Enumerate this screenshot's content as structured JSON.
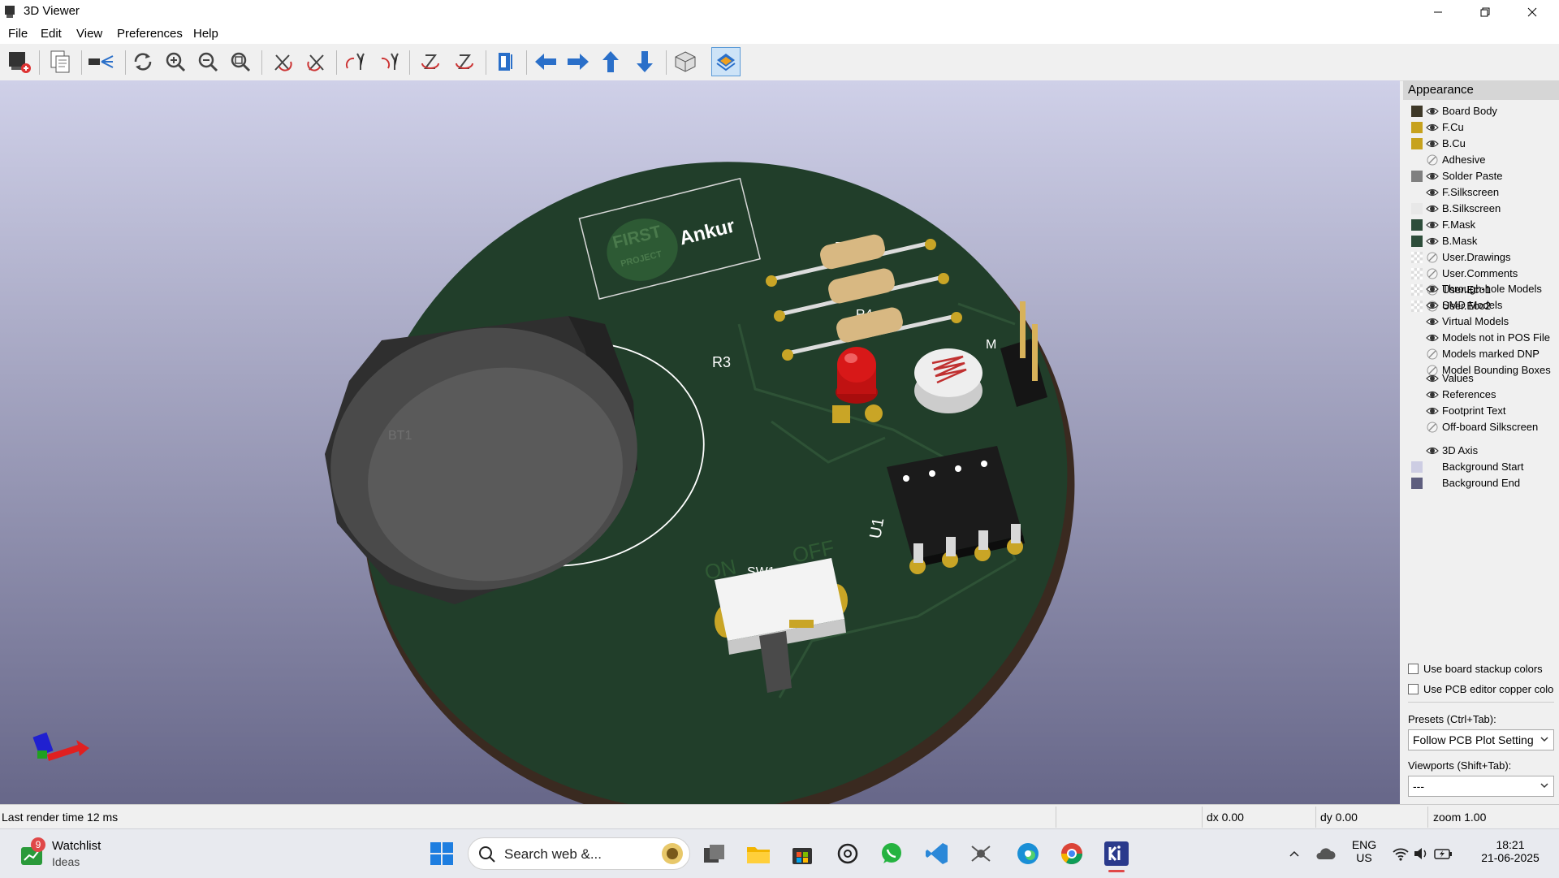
{
  "window": {
    "title": "3D Viewer",
    "controls": [
      "minimize-icon",
      "restore-icon",
      "close-icon"
    ]
  },
  "menu": [
    "File",
    "Edit",
    "View",
    "Preferences",
    "Help"
  ],
  "toolbar": {
    "icons": [
      "reload-board-icon",
      "copy-image-icon",
      "raytrace-icon",
      "refresh-icon",
      "zoom-in-icon",
      "zoom-out-icon",
      "zoom-fit-icon",
      "rotate-x-cw-icon",
      "rotate-x-ccw-icon",
      "rotate-y-cw-icon",
      "rotate-y-ccw-icon",
      "rotate-z-cw-icon",
      "rotate-z-ccw-icon",
      "flip-board-icon",
      "pan-left-icon",
      "pan-right-icon",
      "pan-up-icon",
      "pan-down-icon",
      "orthographic-icon",
      "layers-manager-icon"
    ]
  },
  "board": {
    "silkscreen": [
      "Ankur",
      "FIRST",
      "PROJECT",
      "R1",
      "R4",
      "R3",
      "BT1",
      "U1",
      "ON",
      "OFF",
      "SW1",
      "M"
    ],
    "colors": {
      "soldermask": "#213e2a",
      "copper": "#c9a526",
      "silk": "#ffffff",
      "bg_top": "#cfd0e8",
      "bg_bottom": "#676789"
    }
  },
  "appearance": {
    "title": "Appearance",
    "layers": [
      {
        "label": "Board Body",
        "color": "#3e3828",
        "visible": true
      },
      {
        "label": "F.Cu",
        "color": "#c7a21e",
        "visible": true
      },
      {
        "label": "B.Cu",
        "color": "#c7a21e",
        "visible": true
      },
      {
        "label": "Adhesive",
        "color": "",
        "visible": false
      },
      {
        "label": "Solder Paste",
        "color": "#808080",
        "visible": true
      },
      {
        "label": "F.Silkscreen",
        "color": "#f0f0f0",
        "visible": true
      },
      {
        "label": "B.Silkscreen",
        "color": "#e8e8e8",
        "visible": true
      },
      {
        "label": "F.Mask",
        "color": "#2d4d3a",
        "visible": true
      },
      {
        "label": "B.Mask",
        "color": "#2d4d3a",
        "visible": true
      },
      {
        "label": "User.Drawings",
        "color": "checker",
        "visible": false
      },
      {
        "label": "User.Comments",
        "color": "checker",
        "visible": false
      },
      {
        "label": "User.Eco1",
        "color": "checker",
        "visible": false
      },
      {
        "label": "User.Eco2",
        "color": "checker",
        "visible": false
      }
    ],
    "models": [
      {
        "label": "Through-hole Models",
        "visible": true
      },
      {
        "label": "SMD Models",
        "visible": true
      },
      {
        "label": "Virtual Models",
        "visible": true
      },
      {
        "label": "Models not in POS File",
        "visible": true
      },
      {
        "label": "Models marked DNP",
        "visible": false
      },
      {
        "label": "Model Bounding Boxes",
        "visible": false
      }
    ],
    "texts": [
      {
        "label": "Values",
        "visible": true
      },
      {
        "label": "References",
        "visible": true
      },
      {
        "label": "Footprint Text",
        "visible": true
      },
      {
        "label": "Off-board Silkscreen",
        "visible": false
      }
    ],
    "misc": [
      {
        "label": "3D Axis",
        "color": "",
        "visible": true
      },
      {
        "label": "Background Start",
        "color": "#cdcde3",
        "visible": null
      },
      {
        "label": "Background End",
        "color": "#5e5e7e",
        "visible": null
      }
    ],
    "checkboxes": [
      {
        "label": "Use board stackup colors",
        "checked": false
      },
      {
        "label": "Use PCB editor copper colo",
        "checked": false
      }
    ],
    "presets_label": "Presets (Ctrl+Tab):",
    "presets_value": "Follow PCB Plot Setting",
    "viewports_label": "Viewports (Shift+Tab):",
    "viewports_value": "---"
  },
  "status": {
    "render": "Last render time 12 ms",
    "dx": "dx 0.00",
    "dy": "dy 0.00",
    "zoom": "zoom 1.00"
  },
  "taskbar": {
    "widget_badge": "9",
    "widget_title": "Watchlist",
    "widget_sub": "Ideas",
    "search_placeholder": "Search web &...",
    "lang": "ENG",
    "region": "US",
    "time": "18:21",
    "date": "21-06-2025",
    "apps": [
      "windows-start-icon",
      "search-icon",
      "task-view-icon",
      "file-explorer-icon",
      "ms-store-icon",
      "chatgpt-icon",
      "whatsapp-icon",
      "vscode-icon",
      "app-icon",
      "edge-icon",
      "chrome-icon",
      "kicad-icon"
    ]
  }
}
